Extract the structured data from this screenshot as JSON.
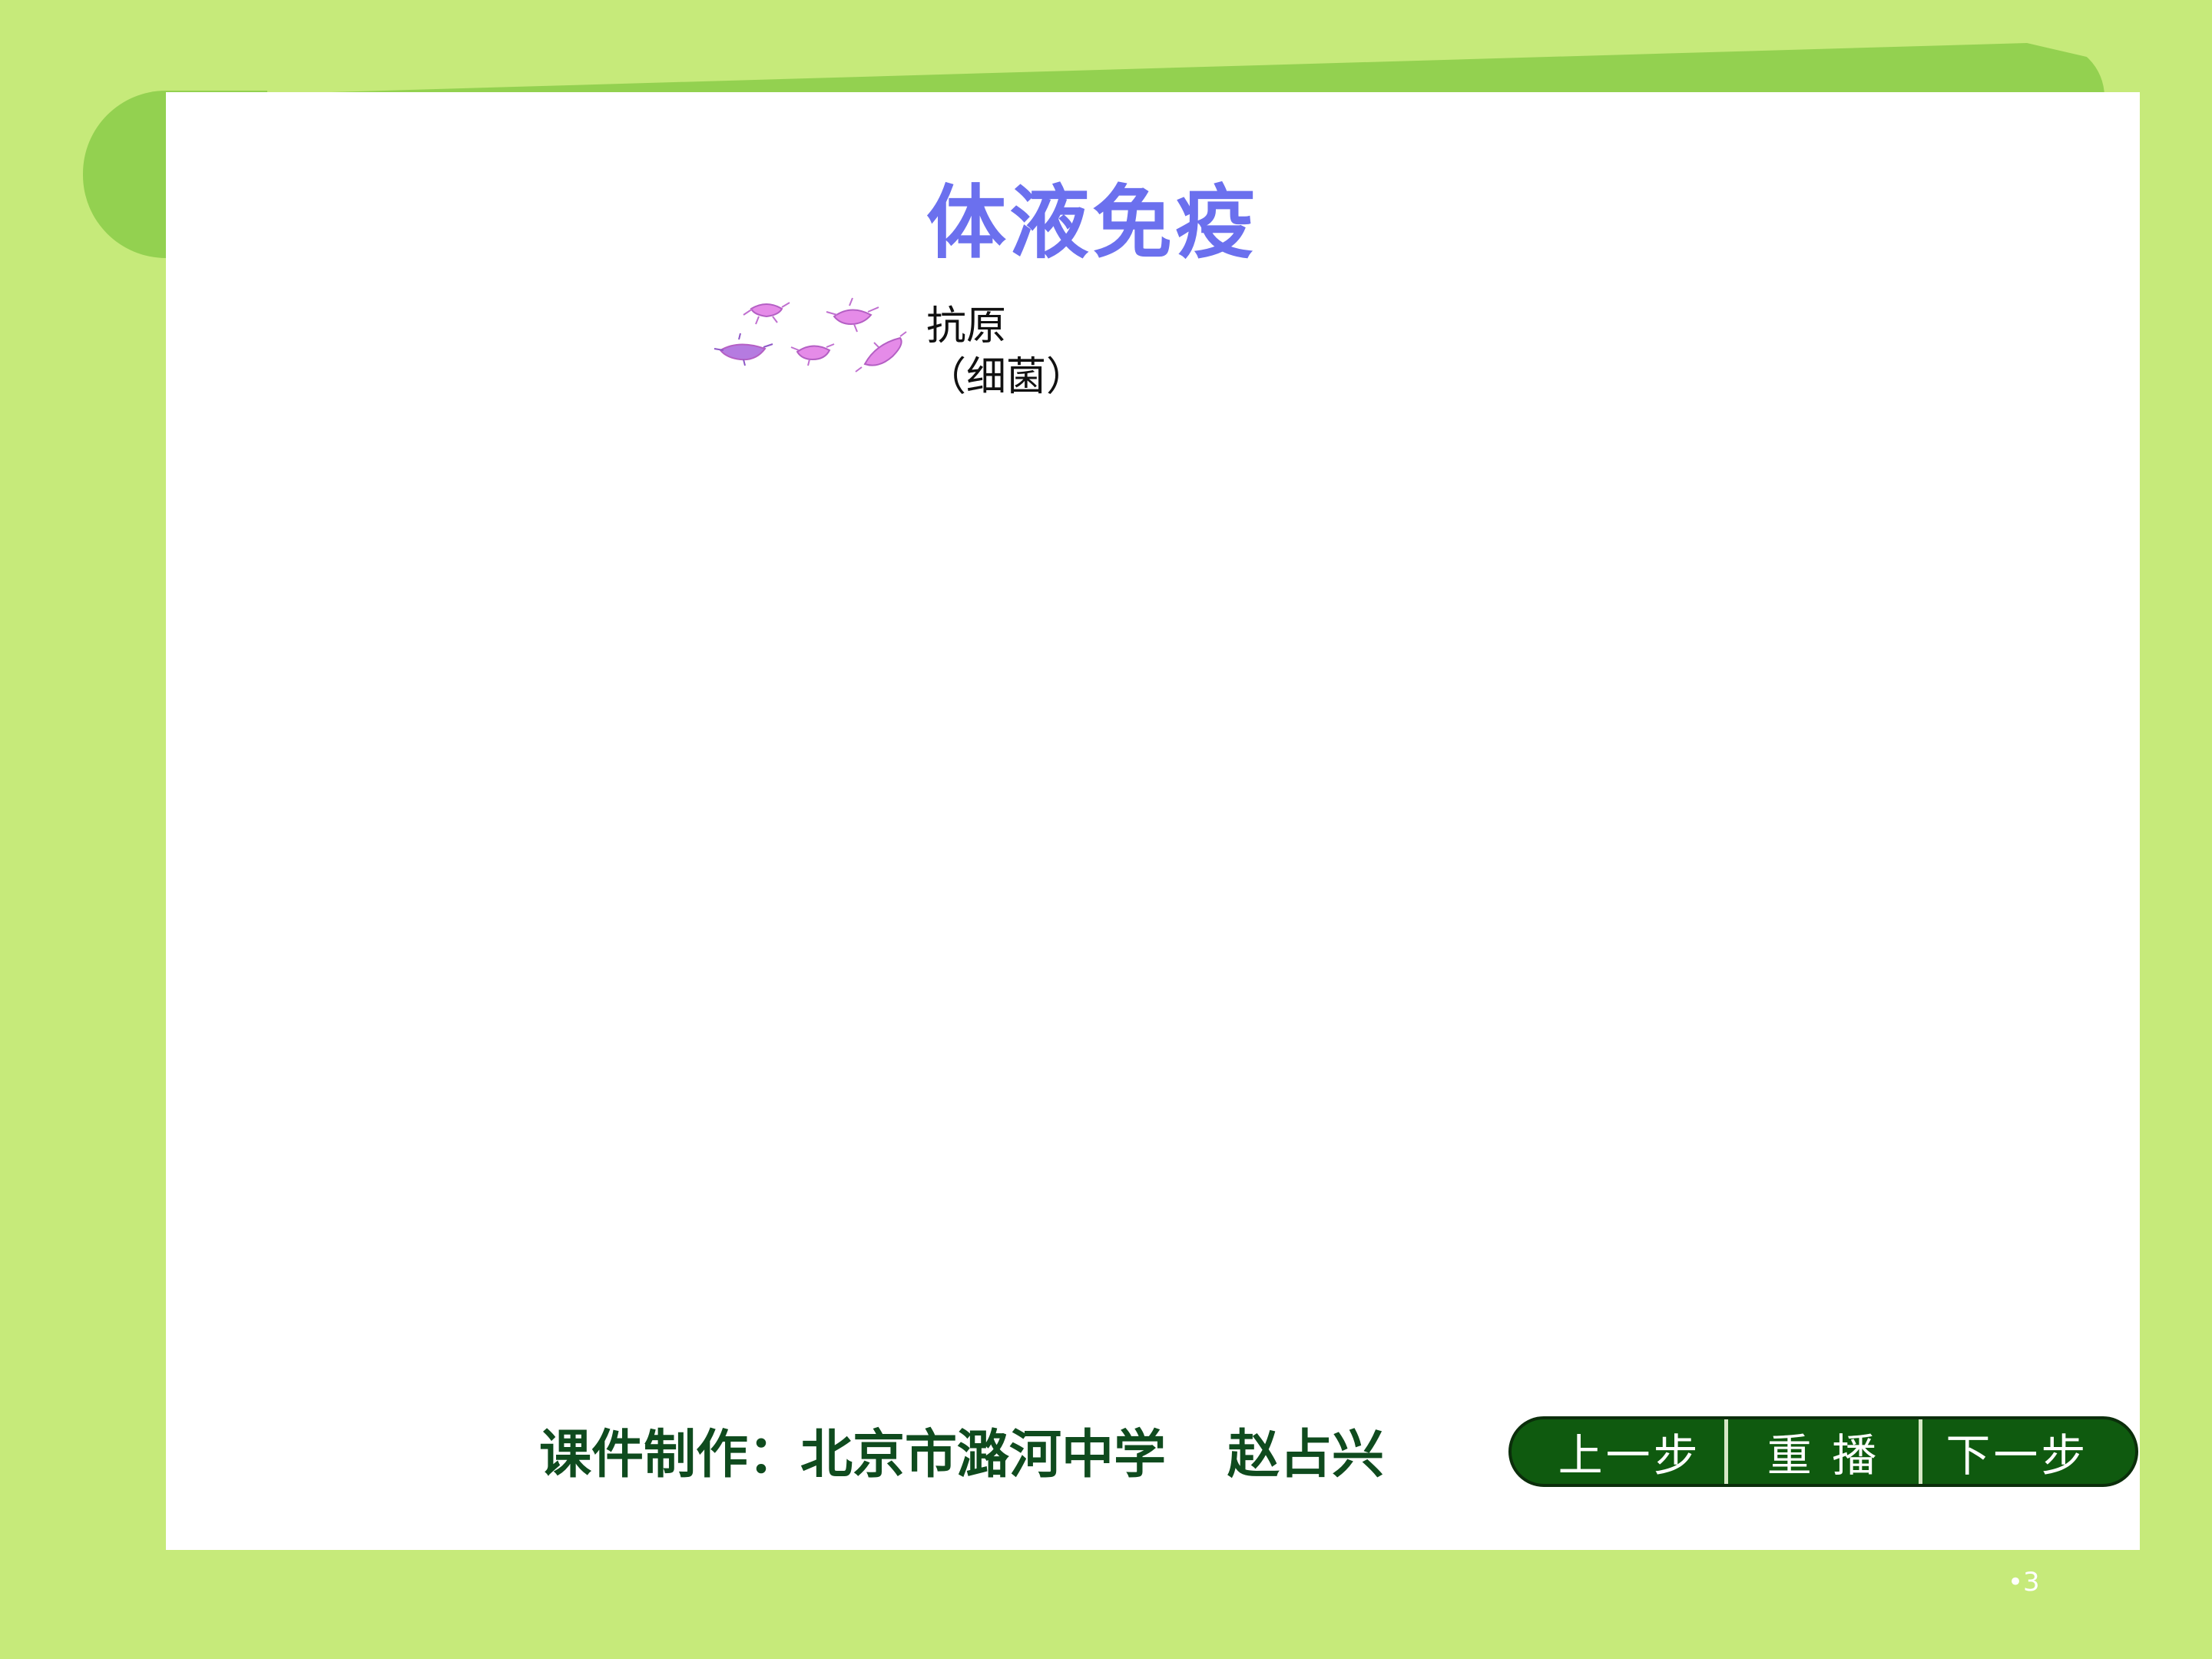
{
  "slide": {
    "title": "体液免疫",
    "antigen": {
      "line1": "抗原",
      "line2": "（细菌）"
    },
    "credit": {
      "maker": "课件制作：北京市潞河中学",
      "author": "赵占兴"
    },
    "nav": {
      "prev_label": "上一步",
      "replay_label": "重 播",
      "next_label": "下一步"
    },
    "page_number": "•3"
  },
  "colors": {
    "background": "#c6ea7a",
    "accent_green": "#93d150",
    "title": "#6b70ee",
    "credit_text": "#0f4b1e",
    "button": "#0f5a0f",
    "bacteria": "#e27ee6"
  },
  "icons": {
    "bacteria": "bacteria-cluster-icon"
  }
}
